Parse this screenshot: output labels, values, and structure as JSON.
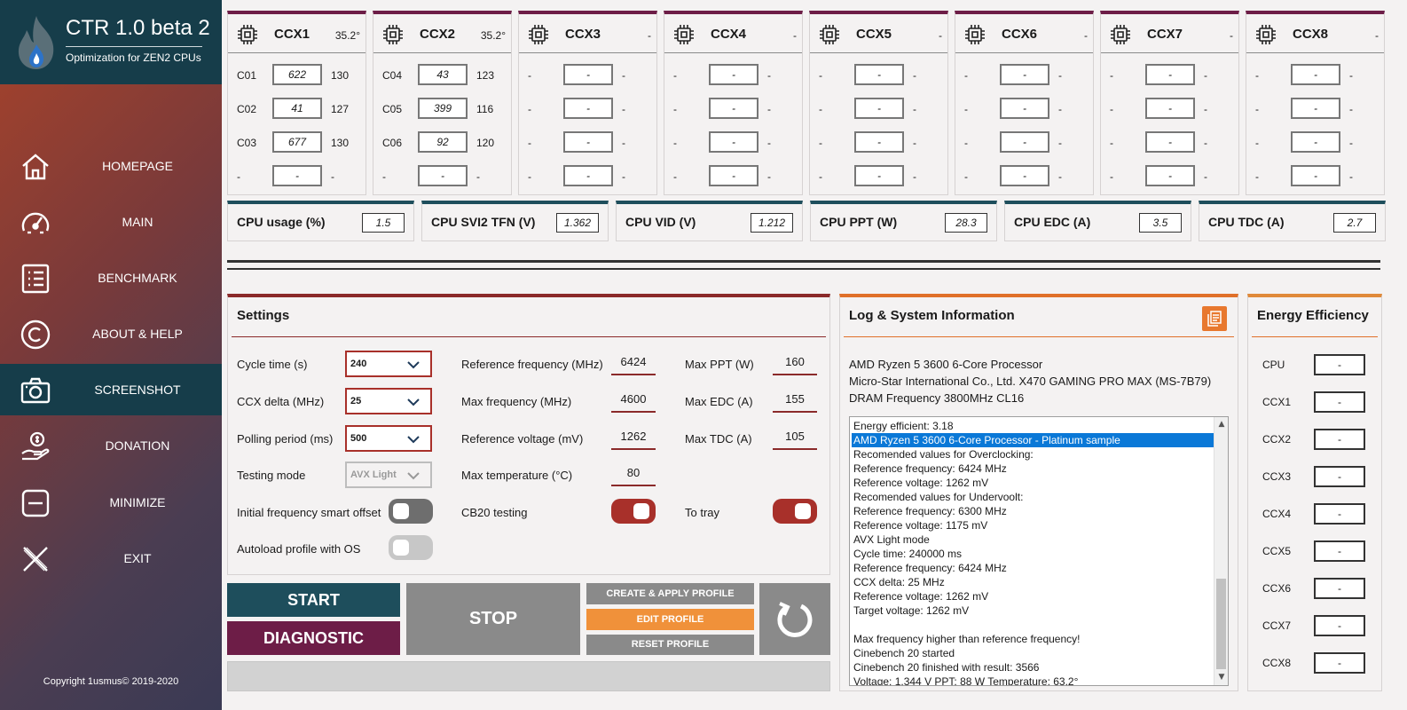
{
  "app": {
    "title": "CTR 1.0 beta 2",
    "subtitle": "Optimization for ZEN2 CPUs",
    "copyright": "Copyright 1usmus© 2019-2020"
  },
  "nav": [
    {
      "label": "HOMEPAGE",
      "icon": "home-icon",
      "active": false
    },
    {
      "label": "MAIN",
      "icon": "speedometer-icon",
      "active": false
    },
    {
      "label": "BENCHMARK",
      "icon": "list-icon",
      "active": false
    },
    {
      "label": "ABOUT & HELP",
      "icon": "copyright-icon",
      "active": false
    },
    {
      "label": "SCREENSHOT",
      "icon": "camera-icon",
      "active": true
    },
    {
      "label": "DONATION",
      "icon": "hand-dollar-icon",
      "active": false
    },
    {
      "label": "MINIMIZE",
      "icon": "minimize-icon",
      "active": false
    },
    {
      "label": "EXIT",
      "icon": "close-icon",
      "active": false
    }
  ],
  "ccx": [
    {
      "name": "CCX1",
      "temp": "35.2°",
      "cores": [
        {
          "label": "C01",
          "freq": "622",
          "val": "130"
        },
        {
          "label": "C02",
          "freq": "41",
          "val": "127"
        },
        {
          "label": "C03",
          "freq": "677",
          "val": "130"
        },
        {
          "label": "-",
          "freq": "-",
          "val": "-"
        }
      ]
    },
    {
      "name": "CCX2",
      "temp": "35.2°",
      "cores": [
        {
          "label": "C04",
          "freq": "43",
          "val": "123"
        },
        {
          "label": "C05",
          "freq": "399",
          "val": "116"
        },
        {
          "label": "C06",
          "freq": "92",
          "val": "120"
        },
        {
          "label": "-",
          "freq": "-",
          "val": "-"
        }
      ]
    },
    {
      "name": "CCX3",
      "temp": "-",
      "cores": [
        {
          "label": "-",
          "freq": "-",
          "val": "-"
        },
        {
          "label": "-",
          "freq": "-",
          "val": "-"
        },
        {
          "label": "-",
          "freq": "-",
          "val": "-"
        },
        {
          "label": "-",
          "freq": "-",
          "val": "-"
        }
      ]
    },
    {
      "name": "CCX4",
      "temp": "-",
      "cores": [
        {
          "label": "-",
          "freq": "-",
          "val": "-"
        },
        {
          "label": "-",
          "freq": "-",
          "val": "-"
        },
        {
          "label": "-",
          "freq": "-",
          "val": "-"
        },
        {
          "label": "-",
          "freq": "-",
          "val": "-"
        }
      ]
    },
    {
      "name": "CCX5",
      "temp": "-",
      "cores": [
        {
          "label": "-",
          "freq": "-",
          "val": "-"
        },
        {
          "label": "-",
          "freq": "-",
          "val": "-"
        },
        {
          "label": "-",
          "freq": "-",
          "val": "-"
        },
        {
          "label": "-",
          "freq": "-",
          "val": "-"
        }
      ]
    },
    {
      "name": "CCX6",
      "temp": "-",
      "cores": [
        {
          "label": "-",
          "freq": "-",
          "val": "-"
        },
        {
          "label": "-",
          "freq": "-",
          "val": "-"
        },
        {
          "label": "-",
          "freq": "-",
          "val": "-"
        },
        {
          "label": "-",
          "freq": "-",
          "val": "-"
        }
      ]
    },
    {
      "name": "CCX7",
      "temp": "-",
      "cores": [
        {
          "label": "-",
          "freq": "-",
          "val": "-"
        },
        {
          "label": "-",
          "freq": "-",
          "val": "-"
        },
        {
          "label": "-",
          "freq": "-",
          "val": "-"
        },
        {
          "label": "-",
          "freq": "-",
          "val": "-"
        }
      ]
    },
    {
      "name": "CCX8",
      "temp": "-",
      "cores": [
        {
          "label": "-",
          "freq": "-",
          "val": "-"
        },
        {
          "label": "-",
          "freq": "-",
          "val": "-"
        },
        {
          "label": "-",
          "freq": "-",
          "val": "-"
        },
        {
          "label": "-",
          "freq": "-",
          "val": "-"
        }
      ]
    }
  ],
  "metrics": [
    {
      "label": "CPU usage (%)",
      "value": "1.5"
    },
    {
      "label": "CPU SVI2 TFN (V)",
      "value": "1.362"
    },
    {
      "label": "CPU VID (V)",
      "value": "1.212"
    },
    {
      "label": "CPU PPT (W)",
      "value": "28.3"
    },
    {
      "label": "CPU EDC (A)",
      "value": "3.5"
    },
    {
      "label": "CPU TDC (A)",
      "value": "2.7"
    }
  ],
  "settings": {
    "title": "Settings",
    "cycle_label": "Cycle time (s)",
    "cycle_value": "240",
    "ccx_delta_label": "CCX delta (MHz)",
    "ccx_delta_value": "25",
    "polling_label": "Polling period (ms)",
    "polling_value": "500",
    "testing_label": "Testing mode",
    "testing_value": "AVX Light",
    "smart_offset_label": "Initial frequency smart offset",
    "autoload_label": "Autoload profile with OS",
    "ref_freq_label": "Reference frequency (MHz)",
    "ref_freq_value": "6424",
    "max_freq_label": "Max frequency (MHz)",
    "max_freq_value": "4600",
    "ref_volt_label": "Reference voltage (mV)",
    "ref_volt_value": "1262",
    "max_temp_label": "Max temperature (°C)",
    "max_temp_value": "80",
    "cb20_label": "CB20 testing",
    "max_ppt_label": "Max PPT (W)",
    "max_ppt_value": "160",
    "max_edc_label": "Max EDC (A)",
    "max_edc_value": "155",
    "max_tdc_label": "Max TDC (A)",
    "max_tdc_value": "105",
    "tray_label": "To tray"
  },
  "buttons": {
    "start": "START",
    "diagnostic": "DIAGNOSTIC",
    "stop": "STOP",
    "create_apply": "CREATE & APPLY PROFILE",
    "edit": "EDIT PROFILE",
    "reset": "RESET PROFILE"
  },
  "log": {
    "title": "Log & System Information",
    "cpu": "AMD Ryzen 5 3600 6-Core Processor",
    "board": "Micro-Star International Co., Ltd. X470 GAMING PRO MAX (MS-7B79)",
    "dram": "DRAM Frequency 3800MHz CL16",
    "lines": [
      "Energy efficient: 3.18",
      "AMD Ryzen 5 3600 6-Core Processor - Platinum sample",
      "Recomended values for Overclocking:",
      "Reference frequency: 6424 MHz",
      "Reference voltage: 1262 mV",
      "Recomended values for Undervoolt:",
      "Reference frequency: 6300 MHz",
      "Reference voltage: 1175 mV",
      "AVX Light mode",
      "Cycle time: 240000 ms",
      "Reference frequency: 6424 MHz",
      "CCX delta: 25 MHz",
      "Reference voltage: 1262 mV",
      "Target voltage: 1262 mV",
      "",
      "Max frequency higher than reference frequency!",
      "Cinebench 20 started",
      "Cinebench 20 finished with result: 3566",
      "Voltage: 1.344 V  PPT: 88 W  Temperature: 63.2°"
    ]
  },
  "energy": {
    "title": "Energy Efficiency",
    "rows": [
      {
        "label": "CPU",
        "value": "-"
      },
      {
        "label": "CCX1",
        "value": "-"
      },
      {
        "label": "CCX2",
        "value": "-"
      },
      {
        "label": "CCX3",
        "value": "-"
      },
      {
        "label": "CCX4",
        "value": "-"
      },
      {
        "label": "CCX5",
        "value": "-"
      },
      {
        "label": "CCX6",
        "value": "-"
      },
      {
        "label": "CCX7",
        "value": "-"
      },
      {
        "label": "CCX8",
        "value": "-"
      }
    ]
  },
  "colors": {
    "sidebar_dark": "#163d4a",
    "ccx_accent": "#6d1d47",
    "metric_accent": "#1e4e5c",
    "settings_accent": "#8b2a2a",
    "log_accent": "#e0702a",
    "start_bg": "#1e4e5c",
    "diagnostic_bg": "#6d1d47",
    "stop_bg": "#8a8a8a",
    "edit_bg": "#f0913a",
    "selection": "#0a78d7"
  }
}
